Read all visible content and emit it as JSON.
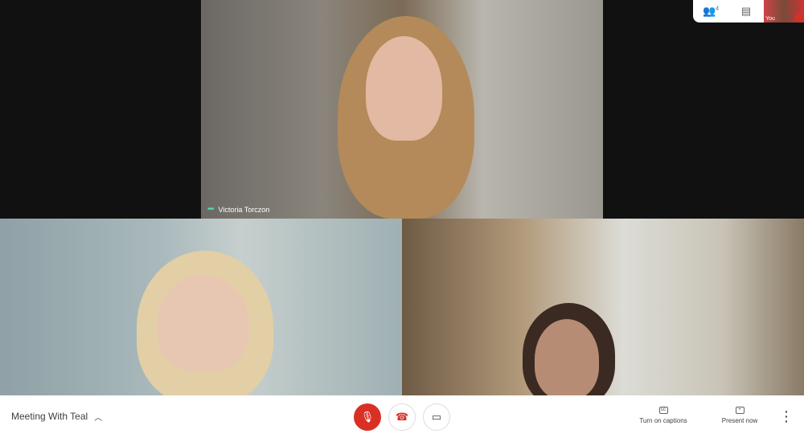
{
  "participants": [
    {
      "name": "Victoria Torczon",
      "speaking": true
    },
    {
      "name": ""
    },
    {
      "name": ""
    }
  ],
  "top_right": {
    "people_icon": "people-icon",
    "people_count": "4",
    "chat_icon": "chat-icon",
    "self_label": "You"
  },
  "bottom_bar": {
    "meeting_title": "Meeting With Teal",
    "mic_icon": "mic-off-icon",
    "hangup_icon": "hang-up-icon",
    "camera_icon": "camera-icon",
    "captions_label": "Turn on captions",
    "present_label": "Present now",
    "more_icon": "more-vert-icon"
  },
  "colors": {
    "mic_muted": "#d93025",
    "hangup": "#d93025",
    "speaking": "#4ee0b0"
  }
}
